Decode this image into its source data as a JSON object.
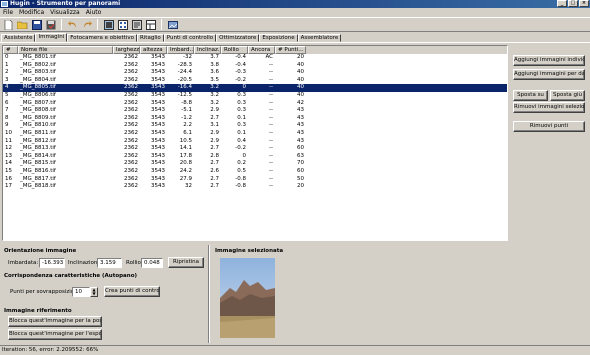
{
  "window": {
    "title": "Hugin - Strumento per panorami",
    "minimize": "_",
    "maximize": "□",
    "close": "×"
  },
  "menu": [
    "File",
    "Modifica",
    "Visualizza",
    "Aiuto"
  ],
  "tabs": [
    "Assistente",
    "Immagini",
    "Fotocamera e obiettivo",
    "Ritaglio",
    "Punti di controllo",
    "Ottimizzatore",
    "Esposizione",
    "Assemblatore"
  ],
  "active_tab": "Immagini",
  "table": {
    "headers": [
      "#",
      "Nome file",
      "larghezza",
      "altezza",
      "Imbard...",
      "Inclinaz...",
      "Rollio",
      "Ancora",
      "# Punti..."
    ],
    "rows": [
      [
        "0",
        "_MG_8801.tif",
        "2362",
        "3543",
        "-32",
        "3.7",
        "-0.4",
        "AC",
        "20"
      ],
      [
        "1",
        "_MG_8802.tif",
        "2362",
        "3543",
        "-28.3",
        "3.8",
        "-0.4",
        "--",
        "40"
      ],
      [
        "2",
        "_MG_8803.tif",
        "2362",
        "3543",
        "-24.4",
        "3.6",
        "-0.3",
        "--",
        "40"
      ],
      [
        "3",
        "_MG_8804.tif",
        "2362",
        "3543",
        "-20.5",
        "3.5",
        "-0.2",
        "--",
        "40"
      ],
      [
        "4",
        "_MG_8805.tif",
        "2362",
        "3543",
        "-16.4",
        "3.2",
        "0",
        "--",
        "40"
      ],
      [
        "5",
        "_MG_8806.tif",
        "2362",
        "3543",
        "-12.5",
        "3.2",
        "0.3",
        "--",
        "40"
      ],
      [
        "6",
        "_MG_8807.tif",
        "2362",
        "3543",
        "-8.8",
        "3.2",
        "0.3",
        "--",
        "42"
      ],
      [
        "7",
        "_MG_8808.tif",
        "2362",
        "3543",
        "-5.1",
        "2.9",
        "0.3",
        "--",
        "43"
      ],
      [
        "8",
        "_MG_8809.tif",
        "2362",
        "3543",
        "-1.2",
        "2.7",
        "0.1",
        "--",
        "43"
      ],
      [
        "9",
        "_MG_8810.tif",
        "2362",
        "3543",
        "2.2",
        "3.1",
        "0.3",
        "--",
        "43"
      ],
      [
        "10",
        "_MG_8811.tif",
        "2362",
        "3543",
        "6.1",
        "2.9",
        "0.1",
        "--",
        "43"
      ],
      [
        "11",
        "_MG_8812.tif",
        "2362",
        "3543",
        "10.5",
        "2.9",
        "0.4",
        "--",
        "43"
      ],
      [
        "12",
        "_MG_8813.tif",
        "2362",
        "3543",
        "14.1",
        "2.7",
        "-0.2",
        "--",
        "60"
      ],
      [
        "13",
        "_MG_8814.tif",
        "2362",
        "3543",
        "17.8",
        "2.8",
        "0",
        "--",
        "63"
      ],
      [
        "14",
        "_MG_8815.tif",
        "2362",
        "3543",
        "20.8",
        "2.7",
        "0.2",
        "--",
        "70"
      ],
      [
        "15",
        "_MG_8816.tif",
        "2362",
        "3543",
        "24.2",
        "2.6",
        "0.5",
        "--",
        "60"
      ],
      [
        "16",
        "_MG_8817.tif",
        "2362",
        "3543",
        "27.9",
        "2.7",
        "-0.8",
        "--",
        "50"
      ],
      [
        "17",
        "_MG_8818.tif",
        "2362",
        "3543",
        "32",
        "2.7",
        "-0.8",
        "--",
        "20"
      ]
    ],
    "selected_row": 4
  },
  "right_buttons": {
    "add_individual": "Aggiungi immagini individuali...",
    "add_by_date": "Aggiungi immagini per data...",
    "move_up": "Sposta su",
    "move_down": "Sposta giù",
    "remove_selected": "Rimuovi immagini selezionate",
    "remove_points": "Rimuovi punti"
  },
  "orientation": {
    "title": "Orientazione immagine",
    "yaw_label": "Imbardata:",
    "yaw": "-16.393",
    "pitch_label": "Inclinazione:",
    "pitch": "3.159",
    "roll_label": "Rollio:",
    "roll": "0.048",
    "reset": "Ripristina"
  },
  "features": {
    "title": "Corrispondenza caratteristiche (Autopano)",
    "points_label": "Punti per sovrapposizione:",
    "points": "10",
    "create": "Crea punti di controllo"
  },
  "reference": {
    "title": "Immagine riferimento",
    "anchor_position": "Blocca quest'immagine per la posizione",
    "anchor_exposure": "Blocca quest'immagine per l'esposizione"
  },
  "selected_image": {
    "title": "Immagine selezionata"
  },
  "status": "Iteration: 56, error: 2.209552: 66%",
  "colors": {
    "selection": "#0a246a",
    "title_start": "#0a246a",
    "title_end": "#3a6ea5"
  }
}
